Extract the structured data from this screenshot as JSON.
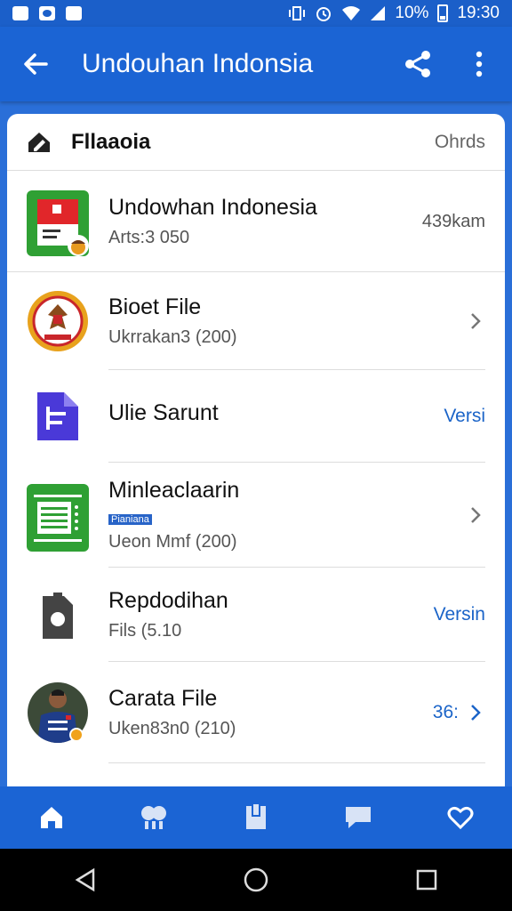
{
  "status_bar": {
    "battery": "10%",
    "time": "19:30"
  },
  "app_bar": {
    "title": "Undouhan Indonsia"
  },
  "card": {
    "header": {
      "title": "Fllaaoia",
      "right": "Ohrds"
    },
    "rows": [
      {
        "title": "Undowhan Indonesia",
        "subtitle": "Arts:3 050",
        "right": "439kam",
        "icon": "indonesia-app-icon"
      },
      {
        "title": "Bioet File",
        "subtitle": "Ukrrakan3 (200)",
        "icon": "garuda-emblem-icon"
      },
      {
        "title": "Ulie Sarunt",
        "action": "Versi",
        "icon": "document-icon"
      },
      {
        "title": "Minleaclaarin",
        "tag": "Pianiana",
        "subtitle": "Ueon Mmf (200)",
        "icon": "spreadsheet-app-icon"
      },
      {
        "title": "Repdodihan",
        "subtitle": "Fils (5.10",
        "action": "Versin",
        "icon": "file-icon"
      },
      {
        "title": "Carata File",
        "subtitle": "Uken83n0 (210)",
        "action": "36:",
        "icon": "player-avatar"
      }
    ]
  },
  "bottom_nav": [
    "home-icon",
    "gallery-icon",
    "clipboard-icon",
    "chat-icon",
    "heart-icon"
  ],
  "colors": {
    "primary": "#1b64d4",
    "status": "#1b5fc9",
    "accent_text": "#1b64c8"
  }
}
